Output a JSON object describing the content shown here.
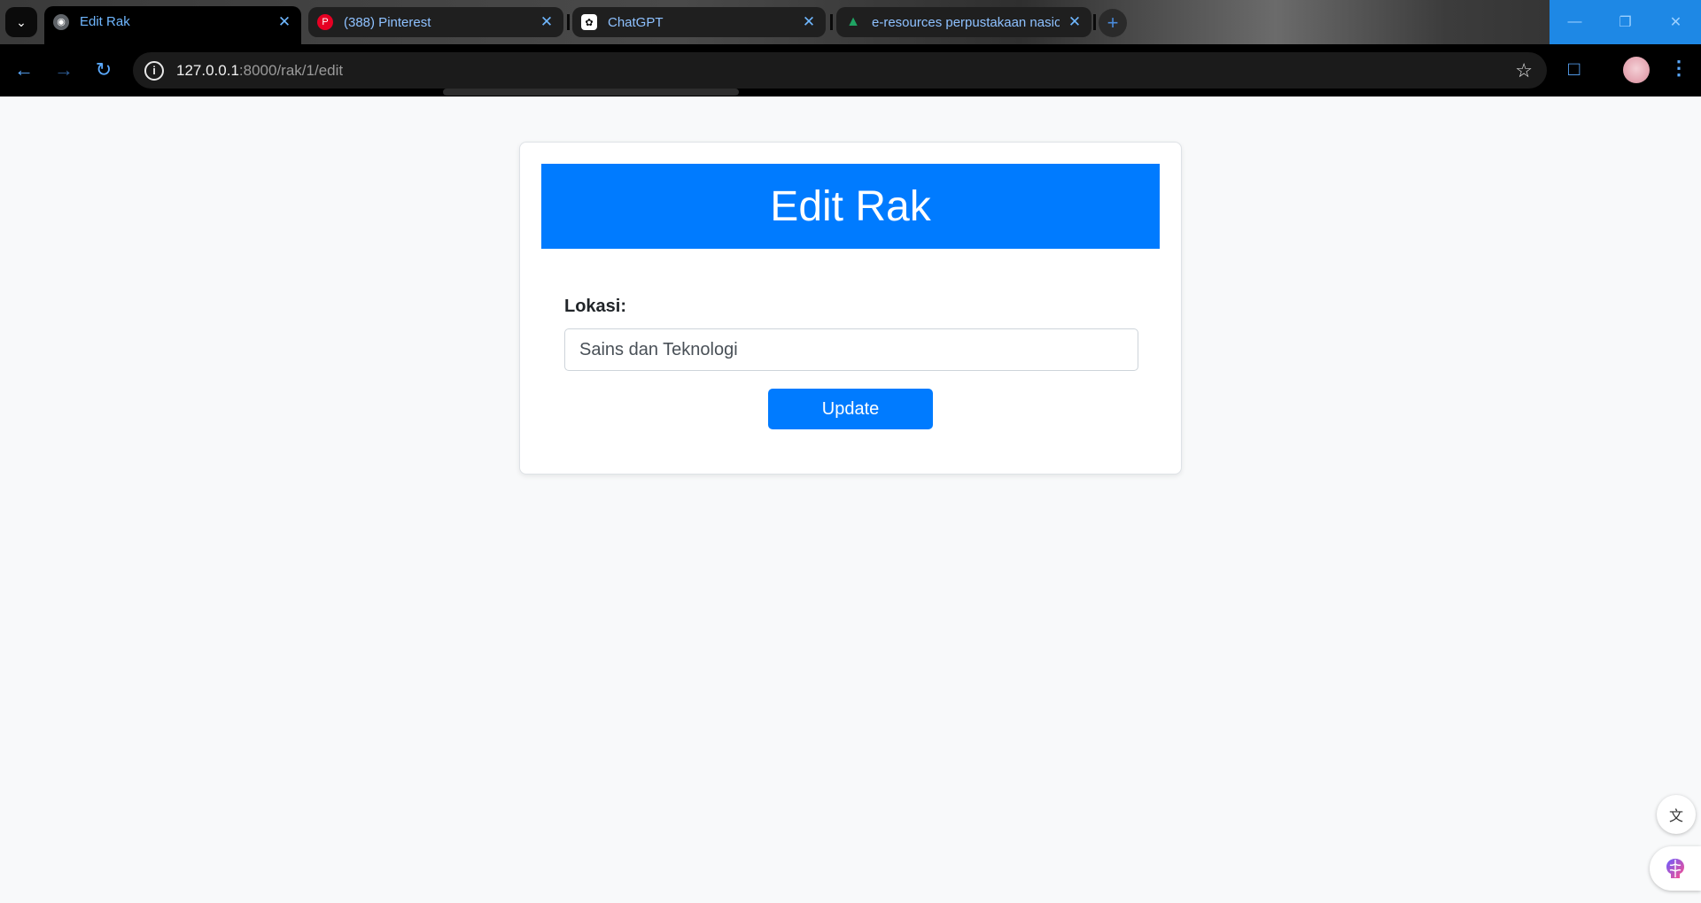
{
  "browser": {
    "tabs": [
      {
        "title": "Edit Rak",
        "favicon": "globe-icon",
        "active": true
      },
      {
        "title": "(388) Pinterest",
        "favicon": "pinterest-icon",
        "active": false
      },
      {
        "title": "ChatGPT",
        "favicon": "chatgpt-icon",
        "active": false
      },
      {
        "title": "e-resources perpustakaan nasio",
        "favicon": "drive-icon",
        "active": false
      }
    ],
    "url_host": "127.0.0.1",
    "url_path": ":8000/rak/1/edit"
  },
  "page": {
    "header_title": "Edit Rak",
    "form": {
      "lokasi_label": "Lokasi:",
      "lokasi_value": "Sains dan Teknologi",
      "submit_label": "Update"
    }
  },
  "colors": {
    "primary": "#007bff",
    "page_bg": "#f8f9fa",
    "tab_accent": "#6fb7ff"
  }
}
